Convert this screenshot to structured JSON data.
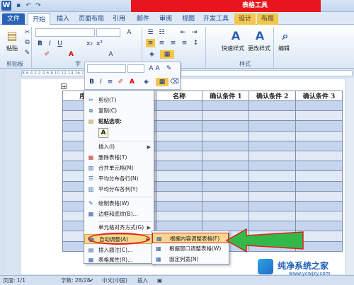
{
  "window": {
    "table_tools_title": "表格工具"
  },
  "tabs": [
    "文件",
    "开始",
    "插入",
    "页面布局",
    "引用",
    "邮件",
    "审阅",
    "视图",
    "开发工具",
    "设计",
    "布局"
  ],
  "ribbon": {
    "clipboard_label": "剪贴板",
    "paste_label": "粘贴",
    "font_label": "字",
    "styles_label": "样式",
    "quick_styles": "快速样式",
    "change_styles": "更改样式",
    "edit_label": "编辑"
  },
  "ruler": "8  6  4  2     2  4  6  8  10  12  14  16  18  20  22  24  26  28  30  32  34  36  38  40  42  44  46",
  "table": {
    "headers": [
      "序号",
      "名称",
      "名称",
      "确认条件 1",
      "确认条件 2",
      "确认条件 3"
    ],
    "row_count": 15
  },
  "minibar": {
    "font_size_letters": "A A"
  },
  "context_menu": {
    "cut": "剪切(T)",
    "copy": "复制(C)",
    "paste_options": "粘贴选项:",
    "paste_icon": "A",
    "insert": "插入(I)",
    "delete_table": "删除表格(T)",
    "merge_cells": "合并单元格(M)",
    "distribute_rows": "平均分布各行(N)",
    "distribute_cols": "平均分布各列(Y)",
    "draw_table": "绘制表格(W)",
    "borders": "边框和底纹(B)...",
    "cell_align": "单元格对齐方式(G)",
    "autofit": "自动调整(A)",
    "insert_caption": "插入题注(C)...",
    "table_props": "表格属性(R)..."
  },
  "submenu": {
    "fit_content": "根据内容调整表格(F)",
    "fit_window": "根据窗口调整表格(W)",
    "fixed_width": "固定列宽(N)"
  },
  "status": {
    "page": "页面: 1/1",
    "words": "字数: 28/28",
    "lang": "中文(中国)",
    "mode": "插入"
  },
  "watermark": {
    "name": "纯净系统之家",
    "url": "www.ycwjzy.com"
  },
  "colors": {
    "accent_red": "#e8161c",
    "highlight": "#f8d88f",
    "table_band": "#c6d5ee"
  }
}
